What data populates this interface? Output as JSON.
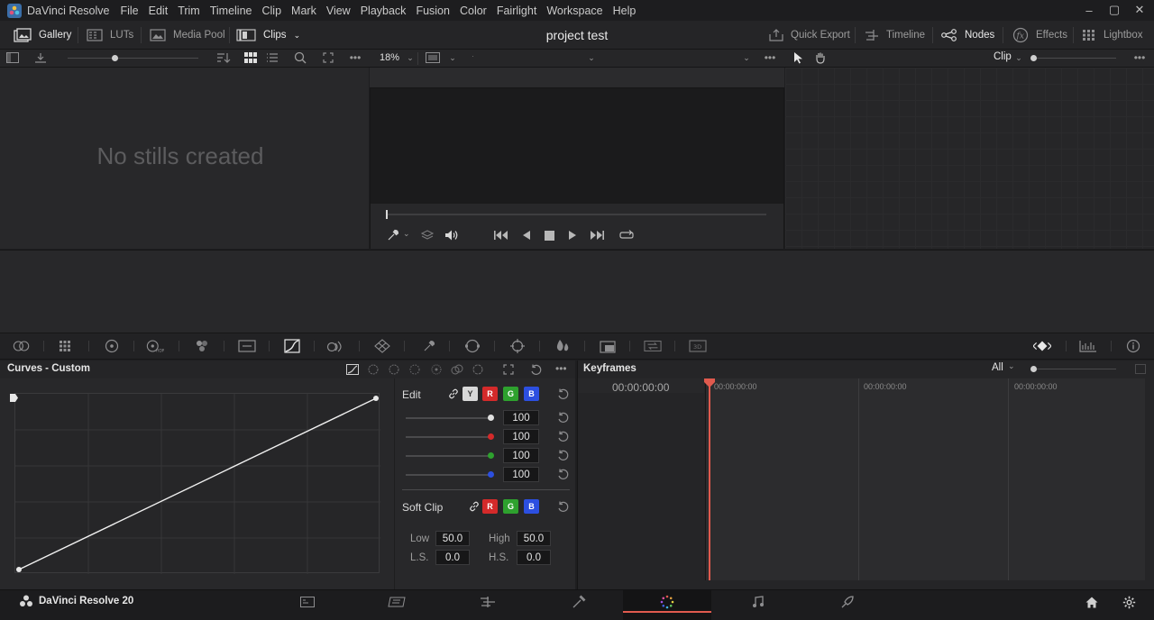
{
  "app": {
    "name": "DaVinci Resolve",
    "menu": [
      "File",
      "Edit",
      "Trim",
      "Timeline",
      "Clip",
      "Mark",
      "View",
      "Playback",
      "Fusion",
      "Color",
      "Fairlight",
      "Workspace",
      "Help"
    ]
  },
  "window_controls": {
    "minimize": "–",
    "maximize": "▢",
    "close": "✕"
  },
  "toolbar": {
    "gallery": "Gallery",
    "luts": "LUTs",
    "media_pool": "Media Pool",
    "clips": "Clips",
    "project_title": "project test",
    "quick_export": "Quick Export",
    "timeline": "Timeline",
    "nodes": "Nodes",
    "effects": "Effects",
    "lightbox": "Lightbox"
  },
  "viewer": {
    "zoom": "18%"
  },
  "nodes": {
    "mode": "Clip"
  },
  "gallery": {
    "empty_message": "No stills created"
  },
  "curves": {
    "title": "Curves - Custom",
    "edit_label": "Edit",
    "channels": [
      "Y",
      "R",
      "G",
      "B"
    ],
    "intensity_values": [
      "100",
      "100",
      "100",
      "100"
    ],
    "soft_clip_label": "Soft Clip",
    "soft_clip_channels": [
      "R",
      "G",
      "B"
    ],
    "low_label": "Low",
    "low": "50.0",
    "high_label": "High",
    "high": "50.0",
    "ls_label": "L.S.",
    "ls": "0.0",
    "hs_label": "H.S.",
    "hs": "0.0"
  },
  "keyframes": {
    "title": "Keyframes",
    "filter": "All",
    "current_tc": "00:00:00:00",
    "ruler": [
      "00:00:00:00",
      "00:00:00:00",
      "00:00:00:00"
    ]
  },
  "pagebar": {
    "brand": "DaVinci Resolve 20"
  },
  "colors": {
    "accent": "#e05a4e",
    "red": "#d42a2a",
    "green": "#2ea12e",
    "blue": "#2c4fe0"
  }
}
